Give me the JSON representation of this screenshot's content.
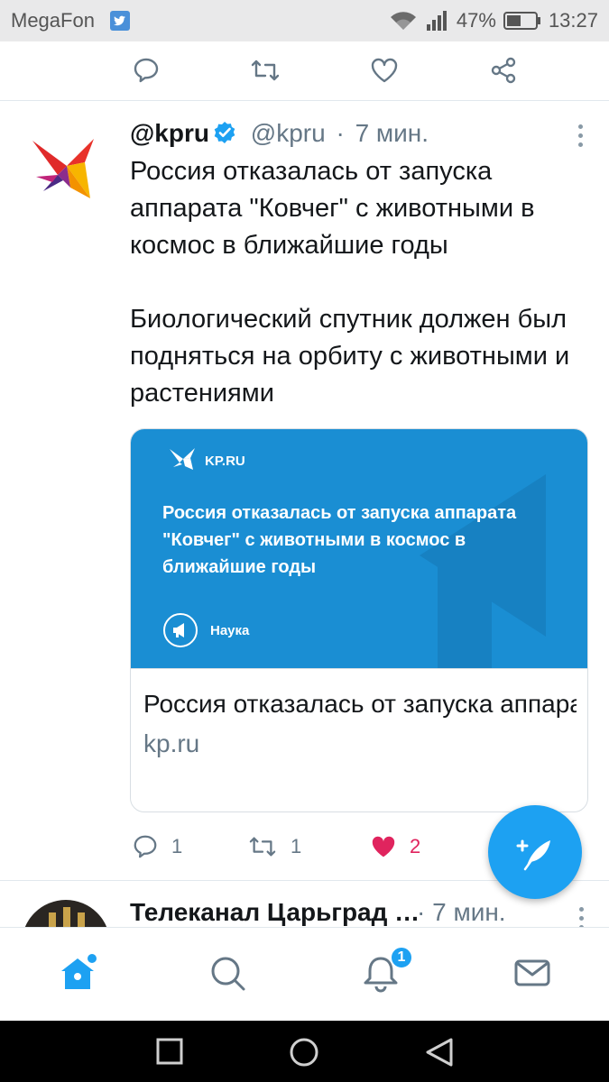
{
  "status_bar": {
    "carrier": "MegaFon",
    "battery": "47%",
    "time": "13:27"
  },
  "prev_tweet_actions": {
    "icons": [
      "reply-icon",
      "retweet-icon",
      "like-icon",
      "share-icon"
    ]
  },
  "tweet": {
    "display_name": "@kpru",
    "handle": "@kpru",
    "separator": "·",
    "time": "7 мин.",
    "text_paragraphs": [
      "Россия отказалась от запуска аппарата \"Ковчег\" с животными в космос в ближайшие годы",
      "Биологический спутник должен был подняться на орбиту с животными и растениями"
    ],
    "card": {
      "image_brand": "KP.RU",
      "image_headline": "Россия отказалась от запуска аппарата \"Ковчег\" с животными в космос в ближайшие годы",
      "image_rubric": "Наука",
      "title": "Россия отказалась от запуска аппарата \"Ковчег\" с ж…",
      "domain": "kp.ru"
    },
    "replies": "1",
    "retweets": "1",
    "likes": "2"
  },
  "next_tweet": {
    "display_name": "Телеканал Царьград …",
    "time": "· 7 мин."
  },
  "bottom_nav": {
    "notifications_badge": "1"
  },
  "colors": {
    "brand_blue": "#1da1f2",
    "card_blue": "#1a8ed3",
    "like_red": "#e0245e",
    "secondary_text": "#657786"
  }
}
